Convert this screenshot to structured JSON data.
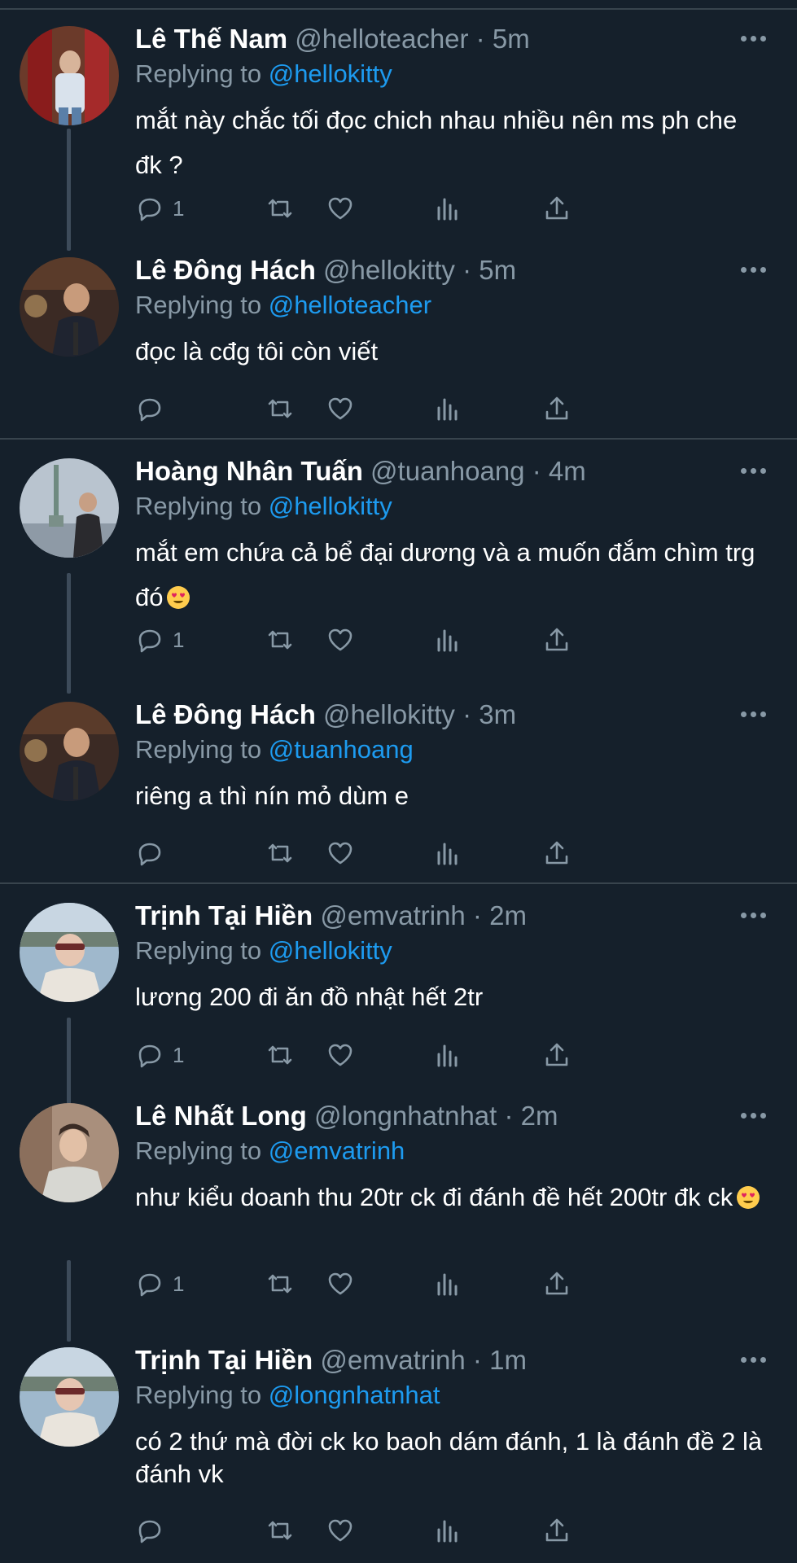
{
  "colors": {
    "background": "#15202b",
    "text": "#ffffff",
    "muted": "#8899a6",
    "link": "#1d9bf0",
    "divider": "#38444d"
  },
  "tweets": [
    {
      "name": "Lê Thế Nam",
      "meta": "@helloteacher · 5m",
      "replying_prefix": "Replying to ",
      "replying_to": "@hellokitty",
      "body": "mắt này chắc tối đọc chich nhau nhiều nên ms ph che đk ?",
      "reply_count": "1",
      "avatar_icon": "profile-photo"
    },
    {
      "name": "Lê Đông Hách",
      "meta": "@hellokitty · 5m",
      "replying_prefix": "Replying to ",
      "replying_to": "@helloteacher",
      "body": "đọc là cđg tôi còn viết",
      "reply_count": "",
      "avatar_icon": "profile-photo"
    },
    {
      "name": "Hoàng Nhân Tuấn",
      "meta": "@tuanhoang · 4m",
      "replying_prefix": "Replying to ",
      "replying_to": "@hellokitty",
      "body": "mắt em chứa cả bể đại dương và a muốn đắm chìm trg đó",
      "emoji": "heart-eyes-emoji",
      "reply_count": "1",
      "avatar_icon": "profile-photo"
    },
    {
      "name": "Lê Đông Hách",
      "meta": "@hellokitty · 3m",
      "replying_prefix": "Replying to ",
      "replying_to": "@tuanhoang",
      "body": "riêng a thì nín mỏ dùm e",
      "reply_count": "",
      "avatar_icon": "profile-photo"
    },
    {
      "name": "Trịnh Tại Hiền",
      "meta": "@emvatrinh · 2m",
      "replying_prefix": "Replying to ",
      "replying_to": "@hellokitty",
      "body": "lương 200 đi ăn đồ nhật hết 2tr",
      "reply_count": "1",
      "avatar_icon": "profile-photo"
    },
    {
      "name": "Lê Nhất Long",
      "meta": "@longnhatnhat · 2m",
      "replying_prefix": "Replying to ",
      "replying_to": "@emvatrinh",
      "body": "như kiểu doanh thu 20tr ck đi đánh đề hết 200tr đk ck",
      "emoji": "heart-eyes-emoji",
      "reply_count": "1",
      "avatar_icon": "profile-photo"
    },
    {
      "name": "Trịnh Tại Hiền",
      "meta": "@emvatrinh · 1m",
      "replying_prefix": "Replying to ",
      "replying_to": "@longnhatnhat",
      "body": "có 2 thứ mà đời ck ko baoh dám đánh, 1 là đánh đề 2 là đánh vk",
      "reply_count": "",
      "avatar_icon": "profile-photo"
    }
  ]
}
